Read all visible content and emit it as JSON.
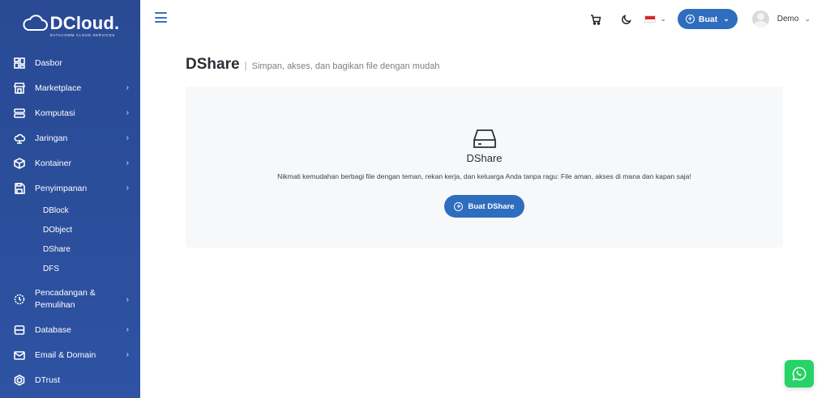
{
  "brand": {
    "name": "DCloud.",
    "tagline": "DATACOMM CLOUD SERVICES"
  },
  "sidebar": {
    "items": [
      {
        "label": "Dasbor",
        "icon": "dashboard-icon",
        "chevron": ""
      },
      {
        "label": "Marketplace",
        "icon": "store-icon",
        "chevron": "›"
      },
      {
        "label": "Komputasi",
        "icon": "server-icon",
        "chevron": "›"
      },
      {
        "label": "Jaringan",
        "icon": "cloud-network-icon",
        "chevron": "›"
      },
      {
        "label": "Kontainer",
        "icon": "cube-icon",
        "chevron": "›"
      },
      {
        "label": "Penyimpanan",
        "icon": "save-icon",
        "chevron": "›"
      },
      {
        "label": "Pencadangan &",
        "label2": "Pemulihan",
        "icon": "history-icon",
        "chevron": "›"
      },
      {
        "label": "Database",
        "icon": "database-icon",
        "chevron": "›"
      },
      {
        "label": "Email & Domain",
        "icon": "mail-icon",
        "chevron": "›"
      },
      {
        "label": "DTrust",
        "icon": "hexagon-icon",
        "chevron": ""
      }
    ],
    "storage_subitems": [
      "DBlock",
      "DObject",
      "DShare",
      "DFS"
    ]
  },
  "topbar": {
    "create_label": "Buat",
    "user_name": "Demo",
    "caret": "⌄",
    "language": "Indonesia"
  },
  "page": {
    "title": "DShare",
    "separator": "|",
    "subtitle": "Simpan, akses, dan bagikan file dengan mudah"
  },
  "card": {
    "title": "DShare",
    "description": "Nikmati kemudahan berbagi file dengan teman, rekan kerja, dan keluarga Anda tanpa ragu: File aman, akses di mana dan kapan saja!",
    "button_label": "Buat DShare"
  },
  "colors": {
    "sidebar": "#2a4a95",
    "primary": "#2f6dbf",
    "whatsapp": "#25d366",
    "card_bg": "#f7f8fa"
  }
}
